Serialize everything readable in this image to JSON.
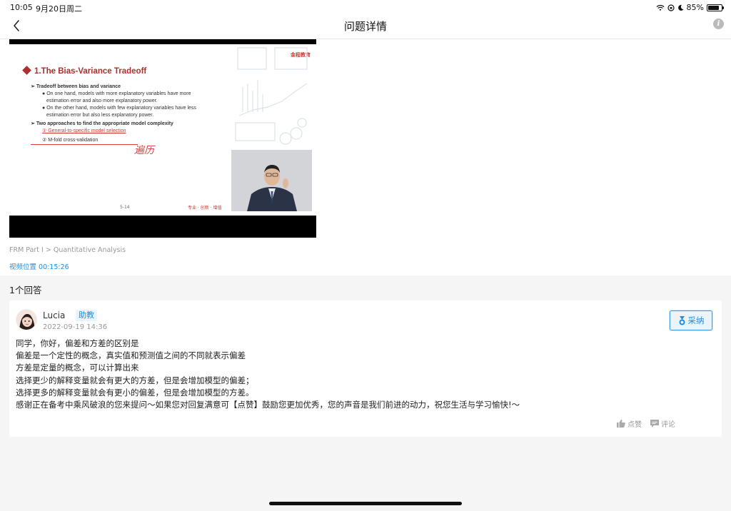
{
  "status_bar": {
    "time": "10:05",
    "date": "9月20日周二",
    "battery": "85%",
    "battery_level": 0.85
  },
  "nav": {
    "title": "问题详情"
  },
  "video": {
    "slide": {
      "logo": "金程教育",
      "heading": "1.The Bias-Variance Tradeoff",
      "bullets": [
        "Tradeoff between bias and variance",
        "On one hand, models with more explanatory variables have more",
        "estimation error and also more explanatory power.",
        "On the other hand, models with few explanatory variables have less",
        "estimation error but also less explanatory power.",
        "Two approaches to find the appropriate model complexity",
        "① General-to-specific model selection",
        "② M-fold cross-validation"
      ],
      "handnote": "遍历",
      "page": "5-14",
      "footer_tag": "专业 · 创新 · 增值"
    }
  },
  "question": {
    "breadcrumb": "FRM Part I > Quantitative Analysis",
    "video_position": "视频位置 00:15:26"
  },
  "answers": {
    "count_label": "1个回答",
    "items": [
      {
        "name": "Lucia",
        "role": "助教",
        "time": "2022-09-19 14:36",
        "accept_label": "采纳",
        "body": [
          "同学，你好，偏差和方差的区别是",
          "偏差是一个定性的概念，真实值和预测值之间的不同就表示偏差",
          "方差是定量的概念，可以计算出来",
          "选择更少的解释变量就会有更大的方差，但是会增加模型的偏差；",
          "选择更多的解释变量就会有更小的偏差，但是会增加模型的方差。",
          "感谢正在备考中乘风破浪的您来提问～如果您对回复满意可【点赞】鼓励您更加优秀，您的声音是我们前进的动力，祝您生活与学习愉快!～"
        ],
        "like_label": "点赞",
        "comment_label": "评论"
      }
    ]
  },
  "colors": {
    "accent": "#1a8ee8",
    "slide_red": "#b22d2d"
  }
}
